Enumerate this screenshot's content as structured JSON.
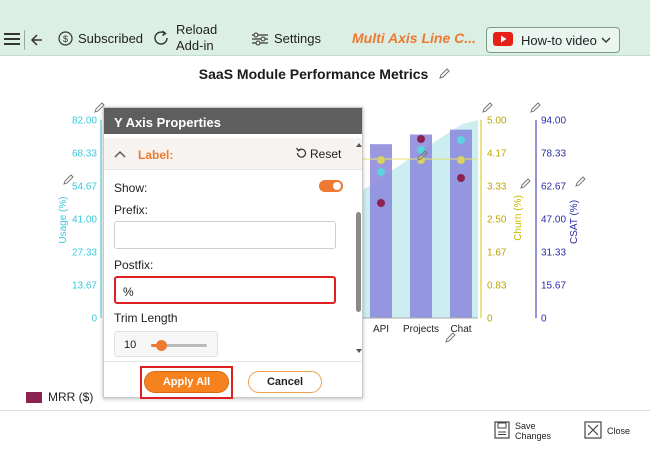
{
  "toolbar": {
    "subscribed_label": "Subscribed",
    "reload_label_line1": "Reload",
    "reload_label_line2": "Add-in",
    "settings_label": "Settings",
    "app_title": "Multi Axis Line C...",
    "howto_label": "How-to video"
  },
  "chart": {
    "title": "SaaS Module Performance Metrics",
    "left_axis_label": "Usage (%)",
    "left_ticks": [
      "82.00",
      "68.33",
      "54.67",
      "41.00",
      "27.33",
      "13.67",
      "0"
    ],
    "churn_axis_label": "Churn (%)",
    "churn_ticks": [
      "5.00",
      "4.17",
      "3.33",
      "2.50",
      "1.67",
      "0.83",
      "0"
    ],
    "csat_axis_label": "CSAT (%)",
    "csat_ticks": [
      "94.00",
      "78.33",
      "62.67",
      "47.00",
      "31.33",
      "15.67",
      "0"
    ],
    "categories_visible": [
      "API",
      "Projects",
      "Chat"
    ],
    "legend_first": "MRR ($)"
  },
  "chart_data": {
    "type": "bar",
    "title": "SaaS Module Performance Metrics",
    "categories": [
      "API",
      "Projects",
      "Chat"
    ],
    "series": [
      {
        "name": "",
        "values": [
          72,
          76,
          78
        ]
      },
      {
        "name": "",
        "values": [
          4.2,
          4.3,
          4.4
        ]
      }
    ],
    "axes": {
      "left": {
        "label": "Usage (%)",
        "range": [
          0,
          82
        ]
      },
      "right_inner": {
        "label": "Churn (%)",
        "range": [
          0,
          5
        ]
      },
      "right_outer": {
        "label": "CSAT (%)",
        "range": [
          0,
          94
        ]
      }
    }
  },
  "panel": {
    "title": "Y Axis Properties",
    "section_label": "Label:",
    "reset_label": "Reset",
    "show_label": "Show:",
    "prefix_label": "Prefix:",
    "prefix_value": "",
    "postfix_label": "Postfix:",
    "postfix_value": "%",
    "trim_label": "Trim Length",
    "trim_value": "10",
    "trim_fraction": 0.1,
    "show_enabled": true,
    "apply_label": "Apply All",
    "cancel_label": "Cancel"
  },
  "bottom": {
    "save_line1": "Save",
    "save_line2": "Changes",
    "close_label": "Close"
  },
  "colors": {
    "toolbar_bg": "#dcefe4",
    "accent_orange": "#ec7a30",
    "usage_axis": "#3cc8dc",
    "churn_axis": "#d4c800",
    "csat_axis": "#2a2aa8",
    "bar": "#8a86dc",
    "highlight_red": "#e02020"
  },
  "icons": [
    "hamburger-icon",
    "back-arrow-icon",
    "dollar-circle-icon",
    "reload-icon",
    "settings-sliders-icon",
    "youtube-icon",
    "chevron-down-icon",
    "pencil-icon",
    "chevron-up-icon",
    "reset-icon",
    "save-icon",
    "close-icon"
  ]
}
